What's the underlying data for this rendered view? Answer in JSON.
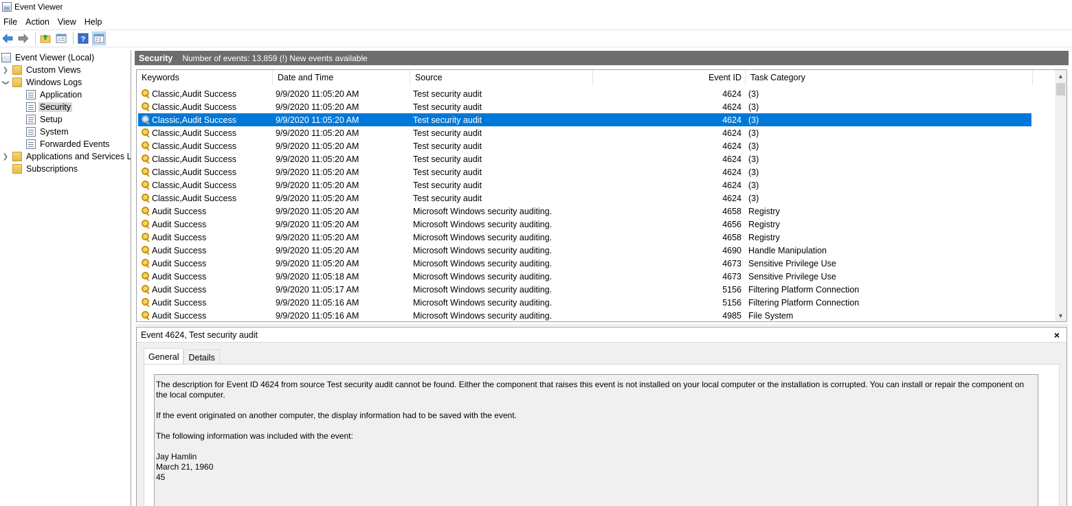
{
  "window": {
    "title": "Event Viewer"
  },
  "menu": [
    "File",
    "Action",
    "View",
    "Help"
  ],
  "toolbar": [
    {
      "name": "back-arrow-icon"
    },
    {
      "name": "forward-arrow-icon"
    },
    {
      "name": "folder-up-icon"
    },
    {
      "name": "properties-icon"
    },
    {
      "name": "help-icon"
    },
    {
      "name": "show-hide-action-pane-icon"
    }
  ],
  "tree": {
    "root": "Event Viewer (Local)",
    "custom_views": "Custom Views",
    "windows_logs": "Windows Logs",
    "logs": [
      "Application",
      "Security",
      "Setup",
      "System",
      "Forwarded Events"
    ],
    "apps_services": "Applications and Services Lo",
    "subscriptions": "Subscriptions"
  },
  "main": {
    "log_name": "Security",
    "summary": "Number of events: 13,859 (!) New events available"
  },
  "columns": [
    "Keywords",
    "Date and Time",
    "Source",
    "Event ID",
    "Task Category"
  ],
  "events": [
    {
      "keywords": "Classic,Audit Success",
      "datetime": "9/9/2020 11:05:20 AM",
      "source": "Test security audit",
      "id": "4624",
      "category": "(3)"
    },
    {
      "keywords": "Classic,Audit Success",
      "datetime": "9/9/2020 11:05:20 AM",
      "source": "Test security audit",
      "id": "4624",
      "category": "(3)"
    },
    {
      "keywords": "Classic,Audit Success",
      "datetime": "9/9/2020 11:05:20 AM",
      "source": "Test security audit",
      "id": "4624",
      "category": "(3)"
    },
    {
      "keywords": "Classic,Audit Success",
      "datetime": "9/9/2020 11:05:20 AM",
      "source": "Test security audit",
      "id": "4624",
      "category": "(3)"
    },
    {
      "keywords": "Classic,Audit Success",
      "datetime": "9/9/2020 11:05:20 AM",
      "source": "Test security audit",
      "id": "4624",
      "category": "(3)"
    },
    {
      "keywords": "Classic,Audit Success",
      "datetime": "9/9/2020 11:05:20 AM",
      "source": "Test security audit",
      "id": "4624",
      "category": "(3)"
    },
    {
      "keywords": "Classic,Audit Success",
      "datetime": "9/9/2020 11:05:20 AM",
      "source": "Test security audit",
      "id": "4624",
      "category": "(3)"
    },
    {
      "keywords": "Classic,Audit Success",
      "datetime": "9/9/2020 11:05:20 AM",
      "source": "Test security audit",
      "id": "4624",
      "category": "(3)"
    },
    {
      "keywords": "Classic,Audit Success",
      "datetime": "9/9/2020 11:05:20 AM",
      "source": "Test security audit",
      "id": "4624",
      "category": "(3)"
    },
    {
      "keywords": "Audit Success",
      "datetime": "9/9/2020 11:05:20 AM",
      "source": "Microsoft Windows security auditing.",
      "id": "4658",
      "category": "Registry"
    },
    {
      "keywords": "Audit Success",
      "datetime": "9/9/2020 11:05:20 AM",
      "source": "Microsoft Windows security auditing.",
      "id": "4656",
      "category": "Registry"
    },
    {
      "keywords": "Audit Success",
      "datetime": "9/9/2020 11:05:20 AM",
      "source": "Microsoft Windows security auditing.",
      "id": "4658",
      "category": "Registry"
    },
    {
      "keywords": "Audit Success",
      "datetime": "9/9/2020 11:05:20 AM",
      "source": "Microsoft Windows security auditing.",
      "id": "4690",
      "category": "Handle Manipulation"
    },
    {
      "keywords": "Audit Success",
      "datetime": "9/9/2020 11:05:20 AM",
      "source": "Microsoft Windows security auditing.",
      "id": "4673",
      "category": "Sensitive Privilege Use"
    },
    {
      "keywords": "Audit Success",
      "datetime": "9/9/2020 11:05:18 AM",
      "source": "Microsoft Windows security auditing.",
      "id": "4673",
      "category": "Sensitive Privilege Use"
    },
    {
      "keywords": "Audit Success",
      "datetime": "9/9/2020 11:05:17 AM",
      "source": "Microsoft Windows security auditing.",
      "id": "5156",
      "category": "Filtering Platform Connection"
    },
    {
      "keywords": "Audit Success",
      "datetime": "9/9/2020 11:05:16 AM",
      "source": "Microsoft Windows security auditing.",
      "id": "5156",
      "category": "Filtering Platform Connection"
    },
    {
      "keywords": "Audit Success",
      "datetime": "9/9/2020 11:05:16 AM",
      "source": "Microsoft Windows security auditing.",
      "id": "4985",
      "category": "File System"
    }
  ],
  "selected_event_index": 2,
  "detail": {
    "title": "Event 4624, Test security audit",
    "close": "×",
    "tabs": [
      "General",
      "Details"
    ],
    "description": [
      "The description for Event ID 4624 from source Test security audit cannot be found. Either the component that raises this event is not installed on your local computer or the installation is corrupted. You can install or repair the component on the local computer.",
      "If the event originated on another computer, the display information had to be saved with the event.",
      "The following information was included with the event:"
    ],
    "info_lines": [
      "Jay Hamlin",
      "March 21, 1960",
      "45"
    ]
  },
  "colors": {
    "selection": "#0078d7",
    "header_bar": "#6d6d6d",
    "tree_selected": "#d9d9d9"
  }
}
